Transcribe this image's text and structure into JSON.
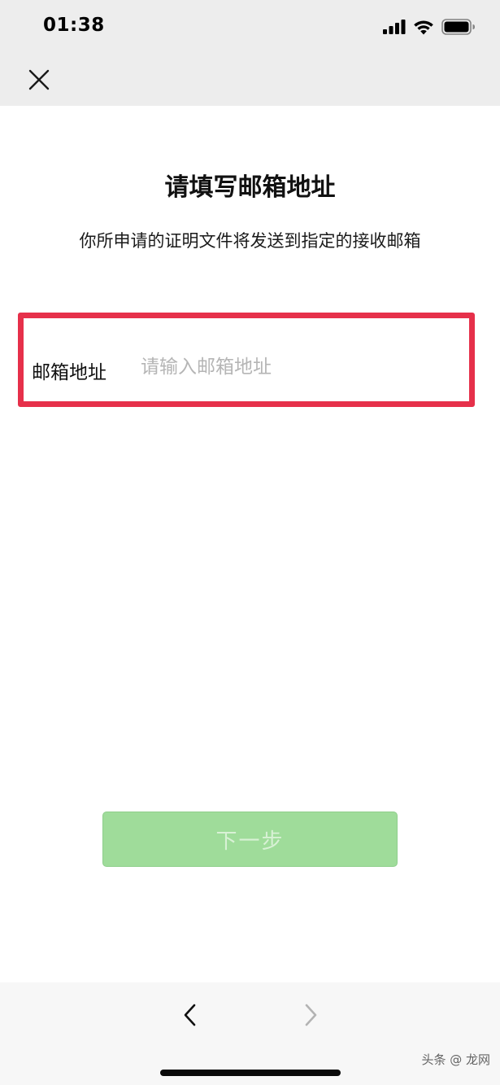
{
  "status_bar": {
    "time": "01:38",
    "icons": [
      "signal-icon",
      "wifi-icon",
      "battery-icon"
    ]
  },
  "nav": {
    "close_icon": "close-icon"
  },
  "page": {
    "title": "请填写邮箱地址",
    "subtitle": "你所申请的证明文件将发送到指定的接收邮箱"
  },
  "form": {
    "email_label": "邮箱地址",
    "email_placeholder": "请输入邮箱地址",
    "email_value": ""
  },
  "actions": {
    "next_label": "下一步"
  },
  "toolbar": {
    "back_icon": "chevron-left-icon",
    "forward_icon": "chevron-right-icon"
  },
  "watermark": {
    "text": "头条 @ 龙网",
    "mark": "龙网"
  },
  "colors": {
    "highlight_border": "#e6304a",
    "button_bg": "#9fdc9a",
    "button_text": "#d8f1d5",
    "header_bg": "#ededed",
    "placeholder": "#b5b5b5"
  }
}
